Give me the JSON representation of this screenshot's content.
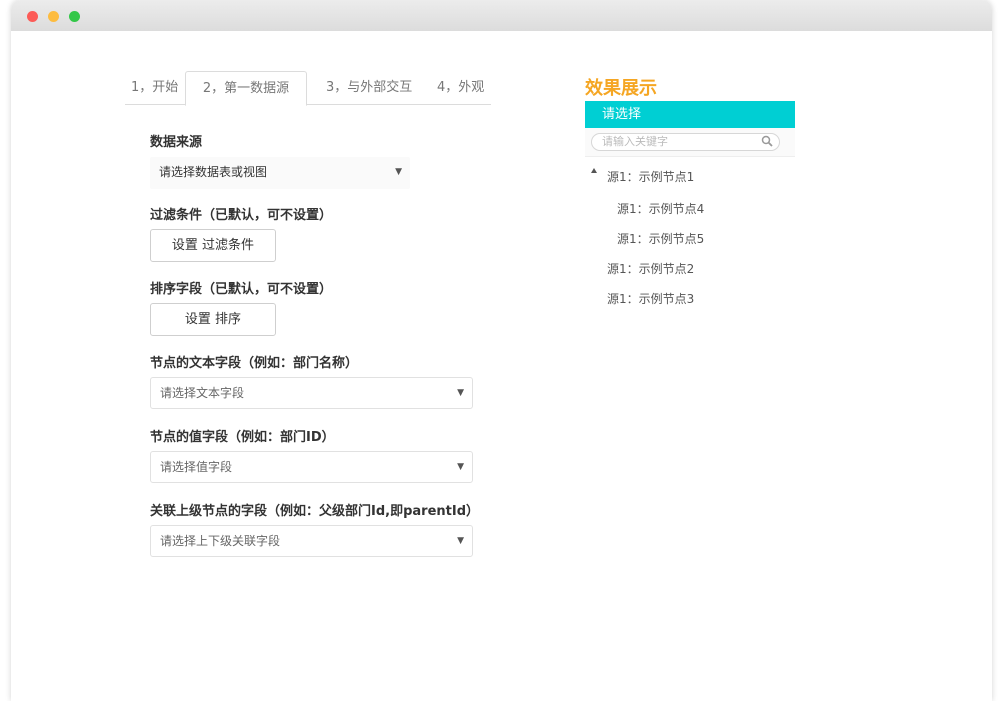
{
  "window": {
    "colors": {
      "red": "#fc5b57",
      "yellow": "#fdbc40",
      "green": "#33c748"
    }
  },
  "tabs": [
    {
      "label": "1，开始"
    },
    {
      "label": "2，第一数据源",
      "active": true
    },
    {
      "label": "3，与外部交互"
    },
    {
      "label": "4，外观"
    }
  ],
  "form": {
    "data_source_label": "数据来源",
    "data_source_value": "请选择数据表或视图",
    "filter_label": "过滤条件（已默认，可不设置）",
    "filter_button": "设置 过滤条件",
    "sort_label": "排序字段（已默认，可不设置）",
    "sort_button": "设置 排序",
    "text_field_label": "节点的文本字段（例如：部门名称）",
    "text_field_value": "请选择文本字段",
    "value_field_label": "节点的值字段（例如：部门ID）",
    "value_field_value": "请选择值字段",
    "parent_field_label": "关联上级节点的字段（例如：父级部门Id,即parentId）",
    "parent_field_value": "请选择上下级关联字段",
    "dropdown_arrow": "▼"
  },
  "preview": {
    "title": "效果展示",
    "header": "请选择",
    "search_placeholder": "请输入关键字",
    "accent_color": "#00cfd3",
    "title_color": "#f5a623",
    "tree": [
      {
        "label": "源1：示例节点1",
        "expanded": true
      },
      {
        "label": "源1：示例节点4"
      },
      {
        "label": "源1：示例节点5"
      },
      {
        "label": "源1：示例节点2"
      },
      {
        "label": "源1：示例节点3"
      }
    ]
  }
}
